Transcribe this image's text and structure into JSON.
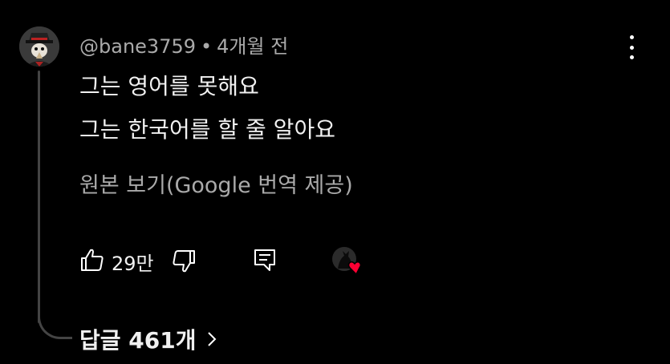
{
  "comment": {
    "author": "@bane3759",
    "separator": "•",
    "time": "4개월 전",
    "lines": [
      "그는 영어를 못해요",
      "그는 한국어를 할 줄 알아요"
    ],
    "translate_label": "원본 보기(Google 번역 제공)",
    "like_count": "29만",
    "reply_count_label": "답글 461개"
  },
  "icons": {
    "avatar": "avatar-image",
    "more": "kebab-menu-icon",
    "like": "thumb-up-icon",
    "dislike": "thumb-down-icon",
    "reply": "reply-icon",
    "creator_heart": "creator-heart-icon",
    "chevron": "chevron-right-icon"
  },
  "colors": {
    "background": "#000000",
    "text": "#f1f1f1",
    "secondary": "#aaaaaa",
    "heart": "#ff0033",
    "thread": "#444444"
  }
}
